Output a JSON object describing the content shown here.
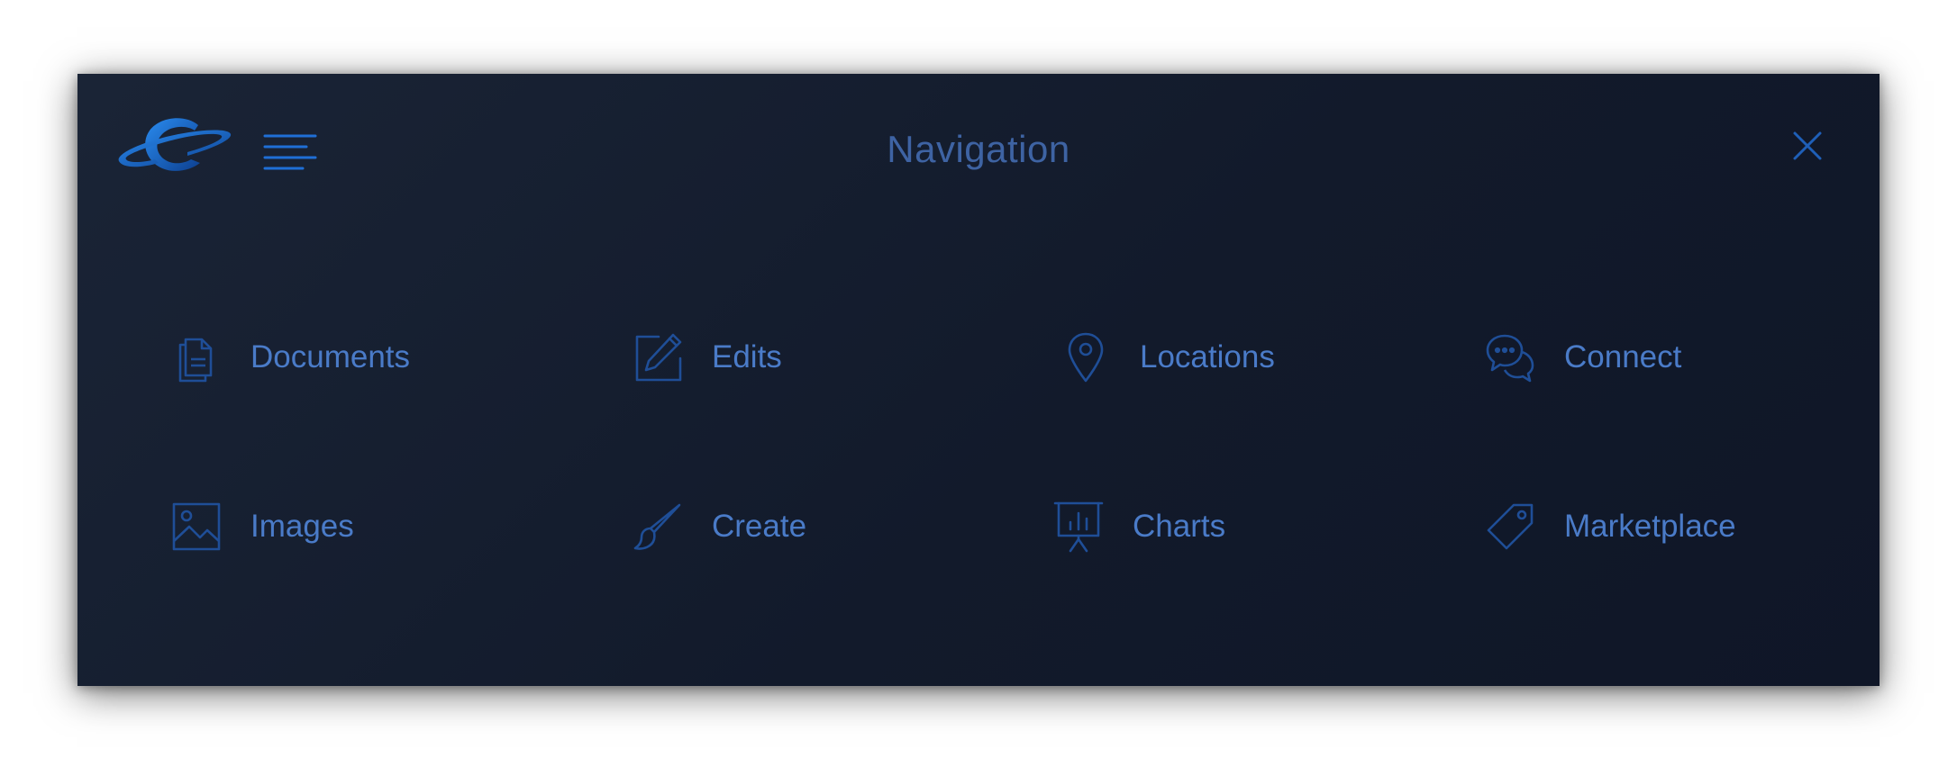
{
  "header": {
    "title": "Navigation",
    "menu_icon": "hamburger-icon",
    "close_icon": "close-icon",
    "logo_icon": "planet-logo"
  },
  "nav_items": [
    {
      "label": "Documents",
      "icon": "documents-icon"
    },
    {
      "label": "Edits",
      "icon": "edit-icon"
    },
    {
      "label": "Locations",
      "icon": "location-pin-icon"
    },
    {
      "label": "Connect",
      "icon": "chat-icon"
    },
    {
      "label": "Images",
      "icon": "image-icon"
    },
    {
      "label": "Create",
      "icon": "brush-icon"
    },
    {
      "label": "Charts",
      "icon": "presentation-chart-icon"
    },
    {
      "label": "Marketplace",
      "icon": "tag-icon"
    }
  ],
  "colors": {
    "background": "#141c2e",
    "accent": "#1f6fd6",
    "icon": "#1f4e97",
    "text": "#4a7bc8",
    "title": "#3e63a3"
  }
}
